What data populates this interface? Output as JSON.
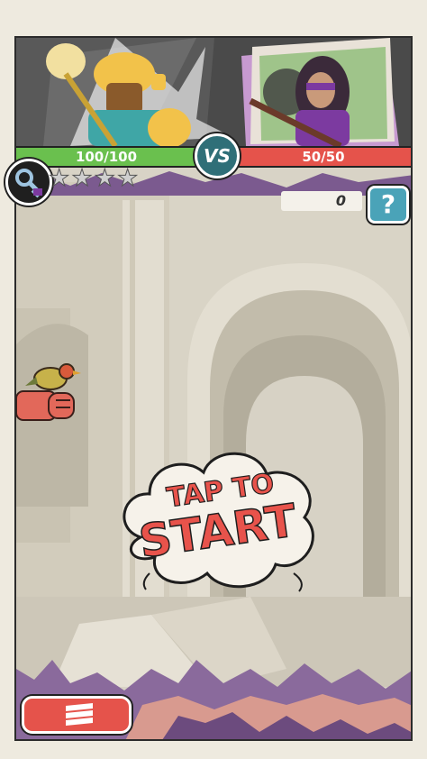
{
  "battle": {
    "player_hp": "100/100",
    "enemy_hp": "50/50",
    "vs_label": "VS"
  },
  "score": {
    "value": "0"
  },
  "stars": {
    "earned": 0,
    "total": 4
  },
  "help": {
    "label": "?"
  },
  "start": {
    "line1": "TAP TO",
    "line2": "START"
  },
  "icons": {
    "key": "key-icon",
    "star": "star-icon",
    "help": "question-icon",
    "menu": "menu-icon",
    "bird": "bird-icon",
    "fist": "fist-icon"
  },
  "colors": {
    "player_bar": "#6ac04e",
    "enemy_bar": "#e5534b",
    "vs": "#2f6f78",
    "help_button": "#4aa3b8",
    "start_text": "#e8534b",
    "paper": "#eeeadf"
  }
}
